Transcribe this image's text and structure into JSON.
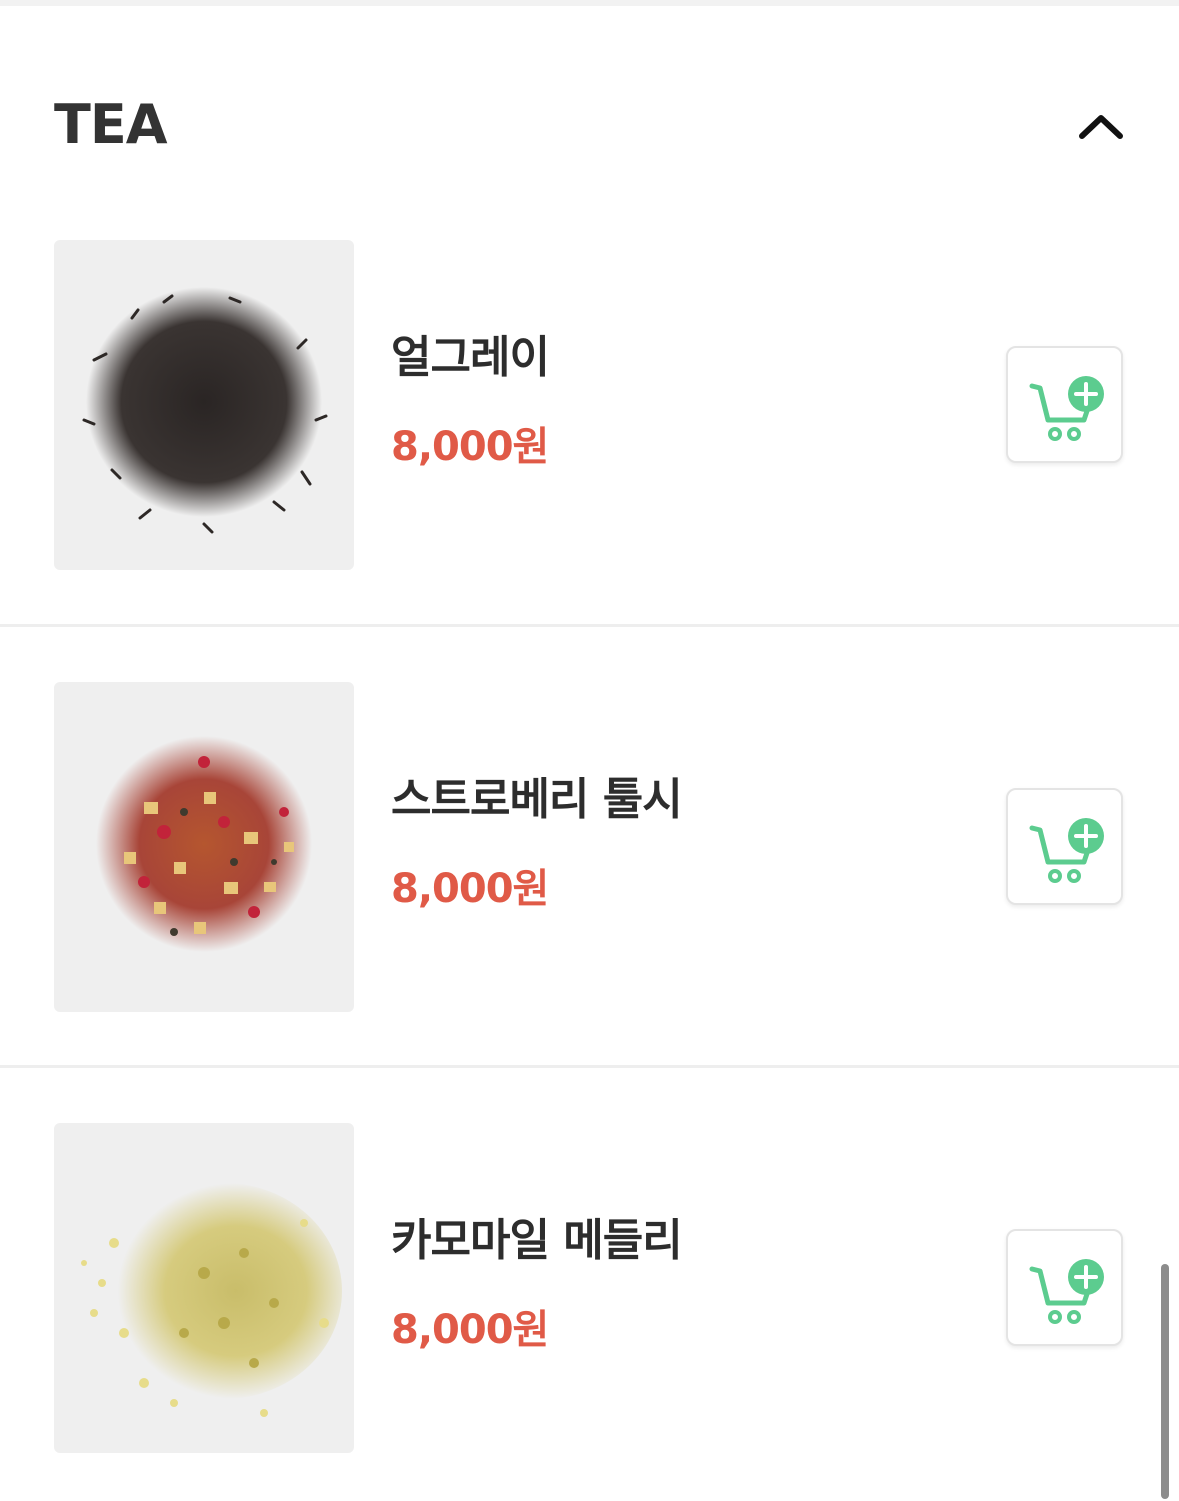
{
  "section": {
    "title": "TEA",
    "toggle_icon": "chevron-up-icon"
  },
  "items": [
    {
      "name": "얼그레이",
      "price": "8,000원",
      "image": "earl-grey-tea-leaves",
      "action_icon": "add-to-cart-icon"
    },
    {
      "name": "스트로베리 툴시",
      "price": "8,000원",
      "image": "strawberry-tulsi-tea-leaves",
      "action_icon": "add-to-cart-icon"
    },
    {
      "name": "카모마일 메들리",
      "price": "8,000원",
      "image": "chamomile-medley-tea-leaves",
      "action_icon": "add-to-cart-icon"
    }
  ],
  "colors": {
    "price": "#e05a47",
    "cart_icon_accent": "#5ccc8f",
    "title": "#333333"
  }
}
